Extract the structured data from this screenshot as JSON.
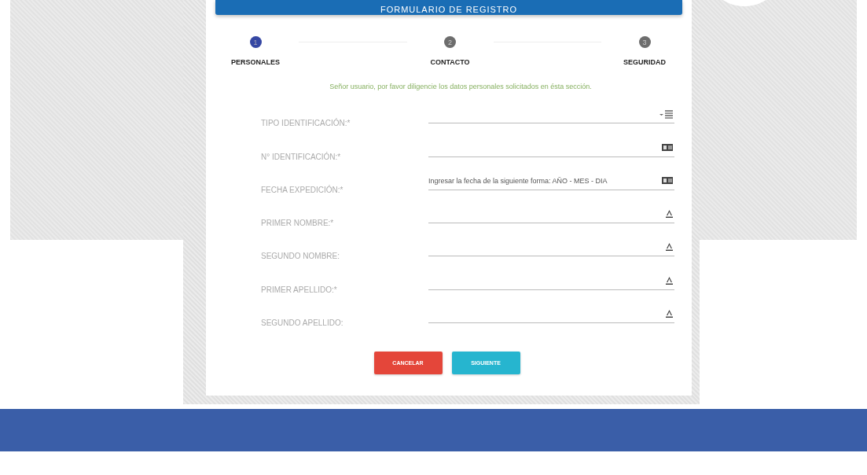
{
  "header": {
    "title": "FORMULARIO DE REGISTRO"
  },
  "steps": [
    {
      "number": "1",
      "label": "PERSONALES",
      "selected": true
    },
    {
      "number": "2",
      "label": "CONTACTO",
      "selected": false
    },
    {
      "number": "3",
      "label": "SEGURIDAD",
      "selected": false
    }
  ],
  "instructions": "Señor usuario, por favor diligencie los datos personales solicitados en ésta sección.",
  "fields": [
    {
      "label": "TIPO IDENTIFICACIÓN:*",
      "kind": "select"
    },
    {
      "label": "N° IDENTIFICACIÓN:*",
      "kind": "number"
    },
    {
      "label": "FECHA EXPEDICIÓN:*",
      "kind": "date",
      "placeholder": "Ingresar la fecha de la siguiente forma: AÑO - MES - DIA"
    },
    {
      "label": "PRIMER NOMBRE:*",
      "kind": "text"
    },
    {
      "label": "SEGUNDO NOMBRE:",
      "kind": "text"
    },
    {
      "label": "PRIMER APELLIDO:*",
      "kind": "text"
    },
    {
      "label": "SEGUNDO APELLIDO:",
      "kind": "text"
    }
  ],
  "buttons": [
    {
      "label": "CANCELAR",
      "kind": "cancel"
    },
    {
      "label": "SIGUIENTE",
      "kind": "next"
    }
  ]
}
